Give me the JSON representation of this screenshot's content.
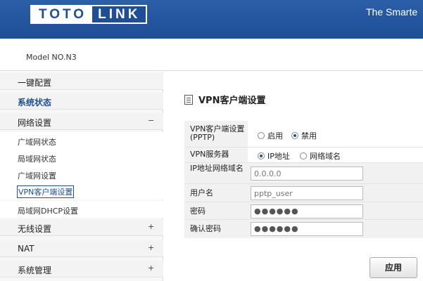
{
  "header": {
    "logo_left": "TOTO",
    "logo_right": "LINK",
    "tagline": "The Smarte"
  },
  "model": "Model NO.N3",
  "sidebar": {
    "items": [
      {
        "label": "一键配置",
        "sign": ""
      },
      {
        "label": "系统状态",
        "sign": ""
      },
      {
        "label": "网络设置",
        "sign": "−"
      },
      {
        "label": "无线设置",
        "sign": "+"
      },
      {
        "label": "NAT",
        "sign": "+"
      },
      {
        "label": "系统管理",
        "sign": "+"
      }
    ],
    "subitems": [
      {
        "label": "广域网状态"
      },
      {
        "label": "局域网状态"
      },
      {
        "label": "广域网设置"
      },
      {
        "label": "VPN客户端设置"
      },
      {
        "label": "局域网DHCP设置"
      }
    ]
  },
  "content": {
    "title": "VPN客户端设置",
    "rows": {
      "vpn_client": {
        "label": "VPN客户端设置(PPTP)",
        "opt_enable": "启用",
        "opt_disable": "禁用",
        "selected": "禁用"
      },
      "vpn_server": {
        "label": "VPN服务器",
        "opt_ip": "IP地址",
        "opt_domain": "网络域名",
        "selected": "IP地址"
      },
      "ip_domain": {
        "label": "IP地址网络域名",
        "placeholder": "0.0.0.0"
      },
      "username": {
        "label": "用户名",
        "placeholder": "pptp_user"
      },
      "password": {
        "label": "密码",
        "value": "●●●●●●"
      },
      "confirm": {
        "label": "确认密码",
        "value": "●●●●●●"
      }
    },
    "apply_label": "应用"
  },
  "colors": {
    "brand": "#1d4e96",
    "header": "#2c5fa8"
  }
}
